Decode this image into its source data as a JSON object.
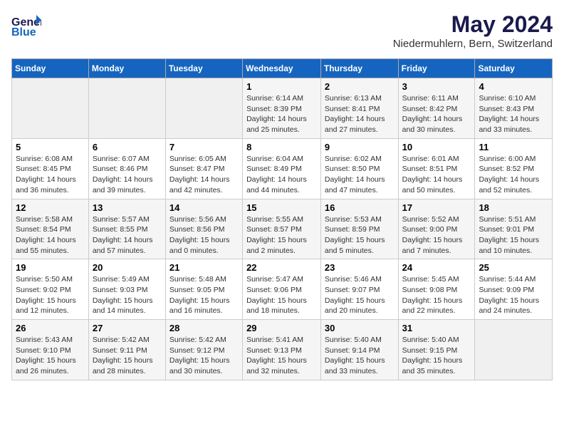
{
  "header": {
    "logo_line1": "General",
    "logo_line2": "Blue",
    "month_year": "May 2024",
    "location": "Niedermuhlern, Bern, Switzerland"
  },
  "weekdays": [
    "Sunday",
    "Monday",
    "Tuesday",
    "Wednesday",
    "Thursday",
    "Friday",
    "Saturday"
  ],
  "weeks": [
    [
      {
        "day": "",
        "detail": ""
      },
      {
        "day": "",
        "detail": ""
      },
      {
        "day": "",
        "detail": ""
      },
      {
        "day": "1",
        "detail": "Sunrise: 6:14 AM\nSunset: 8:39 PM\nDaylight: 14 hours\nand 25 minutes."
      },
      {
        "day": "2",
        "detail": "Sunrise: 6:13 AM\nSunset: 8:41 PM\nDaylight: 14 hours\nand 27 minutes."
      },
      {
        "day": "3",
        "detail": "Sunrise: 6:11 AM\nSunset: 8:42 PM\nDaylight: 14 hours\nand 30 minutes."
      },
      {
        "day": "4",
        "detail": "Sunrise: 6:10 AM\nSunset: 8:43 PM\nDaylight: 14 hours\nand 33 minutes."
      }
    ],
    [
      {
        "day": "5",
        "detail": "Sunrise: 6:08 AM\nSunset: 8:45 PM\nDaylight: 14 hours\nand 36 minutes."
      },
      {
        "day": "6",
        "detail": "Sunrise: 6:07 AM\nSunset: 8:46 PM\nDaylight: 14 hours\nand 39 minutes."
      },
      {
        "day": "7",
        "detail": "Sunrise: 6:05 AM\nSunset: 8:47 PM\nDaylight: 14 hours\nand 42 minutes."
      },
      {
        "day": "8",
        "detail": "Sunrise: 6:04 AM\nSunset: 8:49 PM\nDaylight: 14 hours\nand 44 minutes."
      },
      {
        "day": "9",
        "detail": "Sunrise: 6:02 AM\nSunset: 8:50 PM\nDaylight: 14 hours\nand 47 minutes."
      },
      {
        "day": "10",
        "detail": "Sunrise: 6:01 AM\nSunset: 8:51 PM\nDaylight: 14 hours\nand 50 minutes."
      },
      {
        "day": "11",
        "detail": "Sunrise: 6:00 AM\nSunset: 8:52 PM\nDaylight: 14 hours\nand 52 minutes."
      }
    ],
    [
      {
        "day": "12",
        "detail": "Sunrise: 5:58 AM\nSunset: 8:54 PM\nDaylight: 14 hours\nand 55 minutes."
      },
      {
        "day": "13",
        "detail": "Sunrise: 5:57 AM\nSunset: 8:55 PM\nDaylight: 14 hours\nand 57 minutes."
      },
      {
        "day": "14",
        "detail": "Sunrise: 5:56 AM\nSunset: 8:56 PM\nDaylight: 15 hours\nand 0 minutes."
      },
      {
        "day": "15",
        "detail": "Sunrise: 5:55 AM\nSunset: 8:57 PM\nDaylight: 15 hours\nand 2 minutes."
      },
      {
        "day": "16",
        "detail": "Sunrise: 5:53 AM\nSunset: 8:59 PM\nDaylight: 15 hours\nand 5 minutes."
      },
      {
        "day": "17",
        "detail": "Sunrise: 5:52 AM\nSunset: 9:00 PM\nDaylight: 15 hours\nand 7 minutes."
      },
      {
        "day": "18",
        "detail": "Sunrise: 5:51 AM\nSunset: 9:01 PM\nDaylight: 15 hours\nand 10 minutes."
      }
    ],
    [
      {
        "day": "19",
        "detail": "Sunrise: 5:50 AM\nSunset: 9:02 PM\nDaylight: 15 hours\nand 12 minutes."
      },
      {
        "day": "20",
        "detail": "Sunrise: 5:49 AM\nSunset: 9:03 PM\nDaylight: 15 hours\nand 14 minutes."
      },
      {
        "day": "21",
        "detail": "Sunrise: 5:48 AM\nSunset: 9:05 PM\nDaylight: 15 hours\nand 16 minutes."
      },
      {
        "day": "22",
        "detail": "Sunrise: 5:47 AM\nSunset: 9:06 PM\nDaylight: 15 hours\nand 18 minutes."
      },
      {
        "day": "23",
        "detail": "Sunrise: 5:46 AM\nSunset: 9:07 PM\nDaylight: 15 hours\nand 20 minutes."
      },
      {
        "day": "24",
        "detail": "Sunrise: 5:45 AM\nSunset: 9:08 PM\nDaylight: 15 hours\nand 22 minutes."
      },
      {
        "day": "25",
        "detail": "Sunrise: 5:44 AM\nSunset: 9:09 PM\nDaylight: 15 hours\nand 24 minutes."
      }
    ],
    [
      {
        "day": "26",
        "detail": "Sunrise: 5:43 AM\nSunset: 9:10 PM\nDaylight: 15 hours\nand 26 minutes."
      },
      {
        "day": "27",
        "detail": "Sunrise: 5:42 AM\nSunset: 9:11 PM\nDaylight: 15 hours\nand 28 minutes."
      },
      {
        "day": "28",
        "detail": "Sunrise: 5:42 AM\nSunset: 9:12 PM\nDaylight: 15 hours\nand 30 minutes."
      },
      {
        "day": "29",
        "detail": "Sunrise: 5:41 AM\nSunset: 9:13 PM\nDaylight: 15 hours\nand 32 minutes."
      },
      {
        "day": "30",
        "detail": "Sunrise: 5:40 AM\nSunset: 9:14 PM\nDaylight: 15 hours\nand 33 minutes."
      },
      {
        "day": "31",
        "detail": "Sunrise: 5:40 AM\nSunset: 9:15 PM\nDaylight: 15 hours\nand 35 minutes."
      },
      {
        "day": "",
        "detail": ""
      }
    ]
  ]
}
